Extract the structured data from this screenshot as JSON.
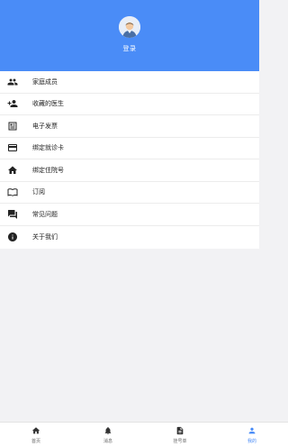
{
  "header": {
    "login_label": "登录",
    "background_color": "#4a8cf7"
  },
  "menu": {
    "items": [
      {
        "label": "家庭成员",
        "icon": "family-icon"
      },
      {
        "label": "收藏的医生",
        "icon": "add-person-icon"
      },
      {
        "label": "电子发票",
        "icon": "invoice-icon"
      },
      {
        "label": "绑定就诊卡",
        "icon": "card-icon"
      },
      {
        "label": "绑定住院号",
        "icon": "home-icon"
      },
      {
        "label": "订阅",
        "icon": "book-icon"
      },
      {
        "label": "常见问题",
        "icon": "chat-icon"
      },
      {
        "label": "关于我们",
        "icon": "info-icon"
      }
    ]
  },
  "tabbar": {
    "tabs": [
      {
        "label": "首页",
        "icon": "home-tab-icon",
        "active": false
      },
      {
        "label": "消息",
        "icon": "bell-icon",
        "active": false
      },
      {
        "label": "挂号单",
        "icon": "document-icon",
        "active": false
      },
      {
        "label": "我的",
        "icon": "person-icon",
        "active": true
      }
    ],
    "active_color": "#4a8cf7"
  }
}
